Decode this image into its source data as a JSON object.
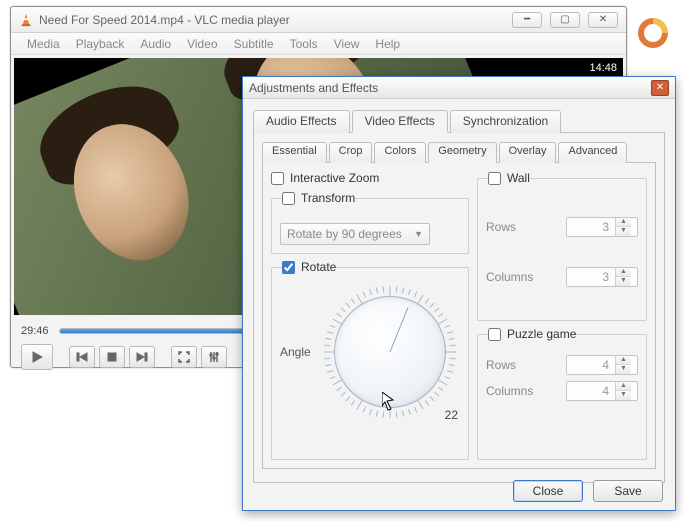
{
  "vlc": {
    "title": "Need For Speed 2014.mp4 - VLC media player",
    "menus": [
      "Media",
      "Playback",
      "Audio",
      "Video",
      "Subtitle",
      "Tools",
      "View",
      "Help"
    ],
    "overlay_time": "14:48",
    "elapsed": "29:46"
  },
  "dialog": {
    "title": "Adjustments and Effects",
    "tabs": [
      "Audio Effects",
      "Video Effects",
      "Synchronization"
    ],
    "active_tab": "Video Effects",
    "subtabs": [
      "Essential",
      "Crop",
      "Colors",
      "Geometry",
      "Overlay",
      "Advanced"
    ],
    "active_subtab": "Geometry",
    "geometry": {
      "interactive_zoom": {
        "label": "Interactive Zoom",
        "checked": false
      },
      "transform": {
        "label": "Transform",
        "checked": false,
        "select_value": "Rotate by 90 degrees"
      },
      "rotate": {
        "label": "Rotate",
        "checked": true,
        "angle_label": "Angle",
        "angle_value": "22"
      },
      "wall": {
        "label": "Wall",
        "checked": false,
        "rows_label": "Rows",
        "rows_value": "3",
        "cols_label": "Columns",
        "cols_value": "3"
      },
      "puzzle": {
        "label": "Puzzle game",
        "checked": false,
        "rows_label": "Rows",
        "rows_value": "4",
        "cols_label": "Columns",
        "cols_value": "4"
      }
    },
    "close": "Close",
    "save": "Save"
  }
}
